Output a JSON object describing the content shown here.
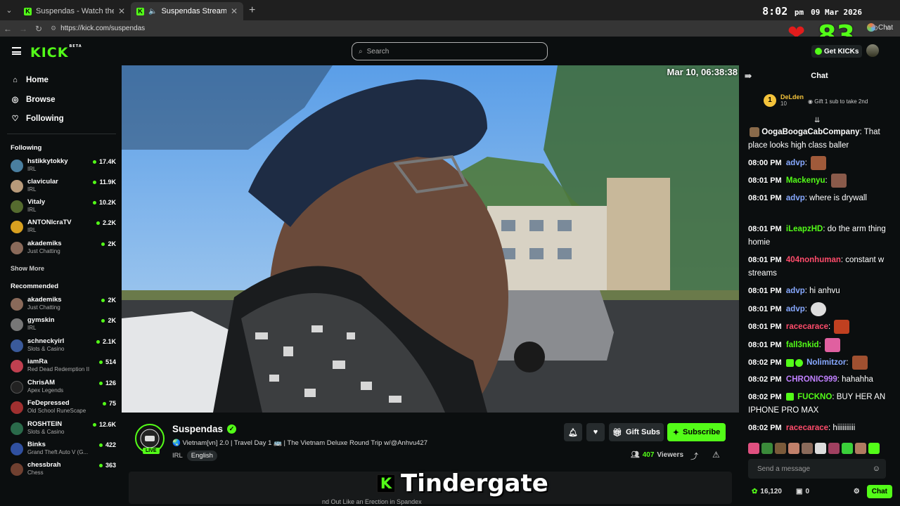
{
  "browser": {
    "tabs": [
      {
        "title": "Suspendas - Watch the VOD on Ki"
      },
      {
        "title": "Suspendas Stream - Watch Li"
      }
    ],
    "new_tab": "+",
    "url": "https://kick.com/suspendas",
    "clock_time": "8:02",
    "clock_ampm": "pm",
    "clock_date": "09 Mar 2026",
    "chat_link": "Chat",
    "heart_count": "83"
  },
  "header": {
    "logo": "KICK",
    "logo_beta": "BETA",
    "search_placeholder": "Search",
    "get_kicks": "Get KICKs"
  },
  "sidebar": {
    "menu": [
      {
        "label": "Home",
        "icon": "home-icon"
      },
      {
        "label": "Browse",
        "icon": "compass-icon"
      },
      {
        "label": "Following",
        "icon": "heart-icon"
      }
    ],
    "following_title": "Following",
    "following": [
      {
        "name": "hstikkytokky",
        "category": "IRL",
        "viewers": "17.4K",
        "color": "#4a7fa0"
      },
      {
        "name": "clavicular",
        "category": "IRL",
        "viewers": "11.9K",
        "color": "#b89a7a"
      },
      {
        "name": "Vitaly",
        "category": "IRL",
        "viewers": "10.2K",
        "color": "#556b2f"
      },
      {
        "name": "ANTONIcraTV",
        "category": "IRL",
        "viewers": "2.2K",
        "color": "#d8a020"
      },
      {
        "name": "akademiks",
        "category": "Just Chatting",
        "viewers": "2K",
        "color": "#8a6a5a"
      }
    ],
    "show_more": "Show More",
    "recommended_title": "Recommended",
    "recommended": [
      {
        "name": "akademiks",
        "category": "Just Chatting",
        "viewers": "2K",
        "color": "#8a6a5a"
      },
      {
        "name": "gymskin",
        "category": "IRL",
        "viewers": "2K",
        "color": "#777"
      },
      {
        "name": "schneckyirl",
        "category": "Slots & Casino",
        "viewers": "2.1K",
        "color": "#3a5a9a"
      },
      {
        "name": "iamRa",
        "category": "Red Dead Redemption II",
        "viewers": "514",
        "color": "#c04050"
      },
      {
        "name": "ChrisAM",
        "category": "Apex Legends",
        "viewers": "126",
        "color": "#222"
      },
      {
        "name": "FeDepressed",
        "category": "Old School RuneScape",
        "viewers": "75",
        "color": "#a03030"
      },
      {
        "name": "ROSHTEIN",
        "category": "Slots & Casino",
        "viewers": "12.6K",
        "color": "#2a6a4a"
      },
      {
        "name": "Binks",
        "category": "Grand Theft Auto V (G...",
        "viewers": "422",
        "color": "#3050a0"
      },
      {
        "name": "chessbrah",
        "category": "Chess",
        "viewers": "363",
        "color": "#704030"
      }
    ]
  },
  "video": {
    "timestamp": "Mar 10, 06:38:38"
  },
  "stream": {
    "streamer": "Suspendas",
    "live": "LIVE",
    "title": "🌏 Vietnam[vn] 2.0 | Travel Day 1 🚌 | The Vietnam Deluxe Round Trip w/@Anhvu427",
    "tags": [
      "IRL",
      "English"
    ],
    "gift_subs": "Gift Subs",
    "subscribe": "Subscribe",
    "viewers": "407",
    "viewers_label": "Viewers",
    "bottom_text": "nd Out Like an Erection in Spandex"
  },
  "overlay": {
    "text": "Tindergate",
    "logo": "K"
  },
  "chat": {
    "title": "Chat",
    "pinned": {
      "rank": "1",
      "name": "DeLden",
      "sub": "10",
      "gift_text": "Gift 1 sub to take 2nd"
    },
    "messages": [
      {
        "time": "",
        "user": "OogaBoogaCabCompany",
        "color": "#ffffff",
        "text": "That place looks high class baller",
        "emote": ""
      },
      {
        "time": "08:00 PM",
        "user": "advp",
        "color": "#86a8ff",
        "text": "",
        "emote": "#a05a3a"
      },
      {
        "time": "08:01 PM",
        "user": "Mackenyu",
        "color": "#53fc18",
        "text": "",
        "emote": "#8a5a4a"
      },
      {
        "time": "08:01 PM",
        "user": "advp",
        "color": "#86a8ff",
        "text": "where is drywall",
        "emote": ""
      },
      {
        "time": "08:01 PM",
        "user": "iLeapzHD",
        "color": "#53fc18",
        "text": "do the arm thing homie",
        "emote": ""
      },
      {
        "time": "08:01 PM",
        "user": "404nonhuman",
        "color": "#ff4c6b",
        "text": "constant w streams",
        "emote": ""
      },
      {
        "time": "08:01 PM",
        "user": "advp",
        "color": "#86a8ff",
        "text": "hi anhvu",
        "emote": ""
      },
      {
        "time": "08:01 PM",
        "user": "advp",
        "color": "#86a8ff",
        "text": "",
        "emote": "#ddd"
      },
      {
        "time": "08:01 PM",
        "user": "racecarace",
        "color": "#ff4c6b",
        "text": "",
        "emote": "#c04020"
      },
      {
        "time": "08:01 PM",
        "user": "fall3nkid",
        "color": "#53fc18",
        "text": "",
        "emote": "#e060a0"
      },
      {
        "time": "08:02 PM",
        "user": "Nolimitzor",
        "color": "#86a8ff",
        "text": "",
        "emote": "#a05030"
      },
      {
        "time": "08:02 PM",
        "user": "CHRONIC999",
        "color": "#c080ff",
        "text": "hahahha",
        "emote": ""
      },
      {
        "time": "08:02 PM",
        "user": "FUCKNO",
        "color": "#53fc18",
        "text": "BUY HER AN IPHONE PRO MAX",
        "emote": ""
      },
      {
        "time": "08:02 PM",
        "user": "racecarace",
        "color": "#ff4c6b",
        "text": "hiiiiiiiiii",
        "emote": ""
      }
    ],
    "emote_bar": [
      "#e05080",
      "#3a8a3a",
      "#7a5a3a",
      "#c0806a",
      "#8a6a5a",
      "#ddd",
      "#a04060",
      "#3ad03a",
      "#b07a60",
      "#53fc18"
    ],
    "input_placeholder": "Send a message",
    "kicks": "16,120",
    "gifts": "0",
    "send_label": "Chat"
  },
  "colors": {
    "accent": "#53fc18",
    "bg": "#0b0e0f"
  }
}
